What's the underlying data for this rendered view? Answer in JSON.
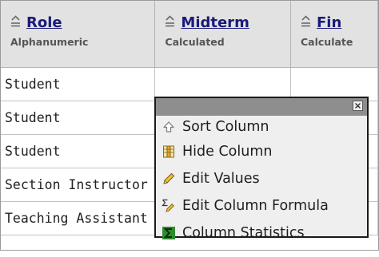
{
  "columns": [
    {
      "title": "Role",
      "subtitle": "Alphanumeric"
    },
    {
      "title": "Midterm",
      "subtitle": "Calculated"
    },
    {
      "title": "Fin",
      "subtitle": "Calculate"
    }
  ],
  "rows": [
    {
      "role": "Student",
      "midterm": "",
      "final": ""
    },
    {
      "role": "Student",
      "midterm": "",
      "final": ""
    },
    {
      "role": "Student",
      "midterm": "",
      "final": ""
    },
    {
      "role": "Section Instructor",
      "midterm": "",
      "final": ""
    },
    {
      "role": "Teaching Assistant",
      "midterm": "",
      "final": ""
    }
  ],
  "menu": {
    "close_icon": "close-icon",
    "items": [
      {
        "label": "Sort Column",
        "icon": "sort-arrow-icon"
      },
      {
        "label": "Hide Column",
        "icon": "hide-column-icon"
      },
      {
        "label": "Edit Values",
        "icon": "pencil-icon"
      },
      {
        "label": "Edit Column Formula",
        "icon": "sigma-pencil-icon"
      },
      {
        "label": "Column Statistics",
        "icon": "sigma-icon"
      }
    ]
  },
  "colors": {
    "header_bg": "#e2e2e2",
    "header_link": "#1a1a7a",
    "menu_bar": "#8e8e8e",
    "menu_bg": "#efefef",
    "statistics_green": "#2e8b2e"
  }
}
